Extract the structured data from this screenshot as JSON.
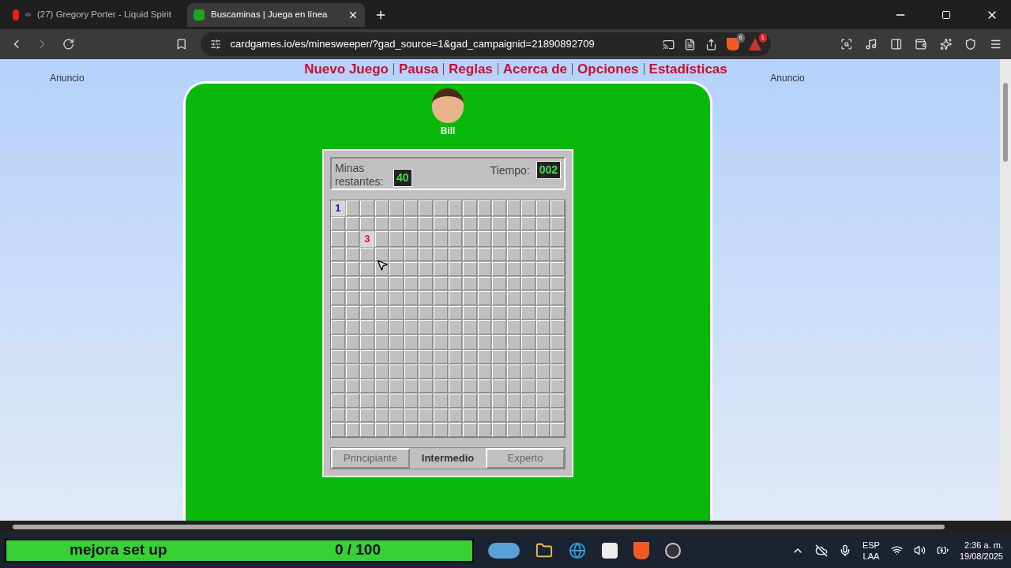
{
  "tabs": [
    {
      "title": "(27) Gregory Porter - Liquid Spirit",
      "audio": true,
      "selected": false
    },
    {
      "title": "Buscaminas | Juega en línea",
      "audio": false,
      "selected": true
    }
  ],
  "address": "cardgames.io/es/minesweeper/?gad_source=1&gad_campaignid=21890892709",
  "badges": [
    {
      "count": "6"
    },
    {
      "count": "1"
    }
  ],
  "nav": [
    "Nuevo Juego",
    "Pausa",
    "Reglas",
    "Acerca de",
    "Opciones",
    "Estadísticas"
  ],
  "ads": [
    "Anuncio",
    "Anuncio"
  ],
  "player": "Bill",
  "mines_label": "Minas restantes:",
  "mines": "40",
  "time_label": "Tiempo:",
  "time": "002",
  "board": [
    [
      {
        "revealed": true,
        "label": "1"
      },
      {
        "revealed": false
      },
      {
        "revealed": false
      },
      {
        "revealed": false
      },
      {
        "revealed": false
      },
      {
        "revealed": false
      },
      {
        "revealed": false
      },
      {
        "revealed": false
      },
      {
        "revealed": false
      },
      {
        "revealed": false
      },
      {
        "revealed": false
      },
      {
        "revealed": false
      },
      {
        "revealed": false
      },
      {
        "revealed": false
      },
      {
        "revealed": false
      },
      {
        "revealed": false
      }
    ],
    [
      {
        "revealed": false
      },
      {
        "revealed": false
      },
      {
        "revealed": false
      },
      {
        "revealed": false
      },
      {
        "revealed": false
      },
      {
        "revealed": false
      },
      {
        "revealed": false
      },
      {
        "revealed": false
      },
      {
        "revealed": false
      },
      {
        "revealed": false
      },
      {
        "revealed": false
      },
      {
        "revealed": false
      },
      {
        "revealed": false
      },
      {
        "revealed": false
      },
      {
        "revealed": false
      },
      {
        "revealed": false
      }
    ],
    [
      {
        "revealed": false
      },
      {
        "revealed": false
      },
      {
        "revealed": true,
        "label": "3"
      },
      {
        "revealed": false
      },
      {
        "revealed": false
      },
      {
        "revealed": false
      },
      {
        "revealed": false
      },
      {
        "revealed": false
      },
      {
        "revealed": false
      },
      {
        "revealed": false
      },
      {
        "revealed": false
      },
      {
        "revealed": false
      },
      {
        "revealed": false
      },
      {
        "revealed": false
      },
      {
        "revealed": false
      },
      {
        "revealed": false
      }
    ],
    [
      {
        "revealed": false
      },
      {
        "revealed": false
      },
      {
        "revealed": false
      },
      {
        "revealed": false
      },
      {
        "revealed": false
      },
      {
        "revealed": false
      },
      {
        "revealed": false
      },
      {
        "revealed": false
      },
      {
        "revealed": false
      },
      {
        "revealed": false
      },
      {
        "revealed": false
      },
      {
        "revealed": false
      },
      {
        "revealed": false
      },
      {
        "revealed": false
      },
      {
        "revealed": false
      },
      {
        "revealed": false
      }
    ],
    [
      {
        "revealed": false
      },
      {
        "revealed": false
      },
      {
        "revealed": false
      },
      {
        "revealed": false
      },
      {
        "revealed": false
      },
      {
        "revealed": false
      },
      {
        "revealed": false
      },
      {
        "revealed": false
      },
      {
        "revealed": false
      },
      {
        "revealed": false
      },
      {
        "revealed": false
      },
      {
        "revealed": false
      },
      {
        "revealed": false
      },
      {
        "revealed": false
      },
      {
        "revealed": false
      },
      {
        "revealed": false
      }
    ],
    [
      {
        "revealed": false
      },
      {
        "revealed": false
      },
      {
        "revealed": false
      },
      {
        "revealed": false
      },
      {
        "revealed": false
      },
      {
        "revealed": false
      },
      {
        "revealed": false
      },
      {
        "revealed": false
      },
      {
        "revealed": false
      },
      {
        "revealed": false
      },
      {
        "revealed": false
      },
      {
        "revealed": false
      },
      {
        "revealed": false
      },
      {
        "revealed": false
      },
      {
        "revealed": false
      },
      {
        "revealed": false
      }
    ],
    [
      {
        "revealed": false
      },
      {
        "revealed": false
      },
      {
        "revealed": false
      },
      {
        "revealed": false
      },
      {
        "revealed": false
      },
      {
        "revealed": false
      },
      {
        "revealed": false
      },
      {
        "revealed": false
      },
      {
        "revealed": false
      },
      {
        "revealed": false
      },
      {
        "revealed": false
      },
      {
        "revealed": false
      },
      {
        "revealed": false
      },
      {
        "revealed": false
      },
      {
        "revealed": false
      },
      {
        "revealed": false
      }
    ],
    [
      {
        "revealed": false
      },
      {
        "revealed": false
      },
      {
        "revealed": false
      },
      {
        "revealed": false
      },
      {
        "revealed": false
      },
      {
        "revealed": false
      },
      {
        "revealed": false
      },
      {
        "revealed": false
      },
      {
        "revealed": false
      },
      {
        "revealed": false
      },
      {
        "revealed": false
      },
      {
        "revealed": false
      },
      {
        "revealed": false
      },
      {
        "revealed": false
      },
      {
        "revealed": false
      },
      {
        "revealed": false
      }
    ],
    [
      {
        "revealed": false
      },
      {
        "revealed": false
      },
      {
        "revealed": false
      },
      {
        "revealed": false
      },
      {
        "revealed": false
      },
      {
        "revealed": false
      },
      {
        "revealed": false
      },
      {
        "revealed": false
      },
      {
        "revealed": false
      },
      {
        "revealed": false
      },
      {
        "revealed": false
      },
      {
        "revealed": false
      },
      {
        "revealed": false
      },
      {
        "revealed": false
      },
      {
        "revealed": false
      },
      {
        "revealed": false
      }
    ],
    [
      {
        "revealed": false
      },
      {
        "revealed": false
      },
      {
        "revealed": false
      },
      {
        "revealed": false
      },
      {
        "revealed": false
      },
      {
        "revealed": false
      },
      {
        "revealed": false
      },
      {
        "revealed": false
      },
      {
        "revealed": false
      },
      {
        "revealed": false
      },
      {
        "revealed": false
      },
      {
        "revealed": false
      },
      {
        "revealed": false
      },
      {
        "revealed": false
      },
      {
        "revealed": false
      },
      {
        "revealed": false
      }
    ],
    [
      {
        "revealed": false
      },
      {
        "revealed": false
      },
      {
        "revealed": false
      },
      {
        "revealed": false
      },
      {
        "revealed": false
      },
      {
        "revealed": false
      },
      {
        "revealed": false
      },
      {
        "revealed": false
      },
      {
        "revealed": false
      },
      {
        "revealed": false
      },
      {
        "revealed": false
      },
      {
        "revealed": false
      },
      {
        "revealed": false
      },
      {
        "revealed": false
      },
      {
        "revealed": false
      },
      {
        "revealed": false
      }
    ],
    [
      {
        "revealed": false
      },
      {
        "revealed": false
      },
      {
        "revealed": false
      },
      {
        "revealed": false
      },
      {
        "revealed": false
      },
      {
        "revealed": false
      },
      {
        "revealed": false
      },
      {
        "revealed": false
      },
      {
        "revealed": false
      },
      {
        "revealed": false
      },
      {
        "revealed": false
      },
      {
        "revealed": false
      },
      {
        "revealed": false
      },
      {
        "revealed": false
      },
      {
        "revealed": false
      },
      {
        "revealed": false
      }
    ],
    [
      {
        "revealed": false
      },
      {
        "revealed": false
      },
      {
        "revealed": false
      },
      {
        "revealed": false
      },
      {
        "revealed": false
      },
      {
        "revealed": false
      },
      {
        "revealed": false
      },
      {
        "revealed": false
      },
      {
        "revealed": false
      },
      {
        "revealed": false
      },
      {
        "revealed": false
      },
      {
        "revealed": false
      },
      {
        "revealed": false
      },
      {
        "revealed": false
      },
      {
        "revealed": false
      },
      {
        "revealed": false
      }
    ],
    [
      {
        "revealed": false
      },
      {
        "revealed": false
      },
      {
        "revealed": false
      },
      {
        "revealed": false
      },
      {
        "revealed": false
      },
      {
        "revealed": false
      },
      {
        "revealed": false
      },
      {
        "revealed": false
      },
      {
        "revealed": false
      },
      {
        "revealed": false
      },
      {
        "revealed": false
      },
      {
        "revealed": false
      },
      {
        "revealed": false
      },
      {
        "revealed": false
      },
      {
        "revealed": false
      },
      {
        "revealed": false
      }
    ],
    [
      {
        "revealed": false
      },
      {
        "revealed": false
      },
      {
        "revealed": false
      },
      {
        "revealed": false
      },
      {
        "revealed": false
      },
      {
        "revealed": false
      },
      {
        "revealed": false
      },
      {
        "revealed": false
      },
      {
        "revealed": false
      },
      {
        "revealed": false
      },
      {
        "revealed": false
      },
      {
        "revealed": false
      },
      {
        "revealed": false
      },
      {
        "revealed": false
      },
      {
        "revealed": false
      },
      {
        "revealed": false
      }
    ],
    [
      {
        "revealed": false
      },
      {
        "revealed": false
      },
      {
        "revealed": false
      },
      {
        "revealed": false
      },
      {
        "revealed": false
      },
      {
        "revealed": false
      },
      {
        "revealed": false
      },
      {
        "revealed": false
      },
      {
        "revealed": false
      },
      {
        "revealed": false
      },
      {
        "revealed": false
      },
      {
        "revealed": false
      },
      {
        "revealed": false
      },
      {
        "revealed": false
      },
      {
        "revealed": false
      },
      {
        "revealed": false
      }
    ]
  ],
  "levels": [
    {
      "label": "Principiante",
      "selected": false
    },
    {
      "label": "Intermedio",
      "selected": true
    },
    {
      "label": "Experto",
      "selected": false
    }
  ],
  "overlay": {
    "label": "mejora set up",
    "count": "0 / 100"
  },
  "tray": {
    "lang": "ESP",
    "layout": "LAA",
    "time": "2:36 a. m.",
    "date": "19/08/2025"
  }
}
